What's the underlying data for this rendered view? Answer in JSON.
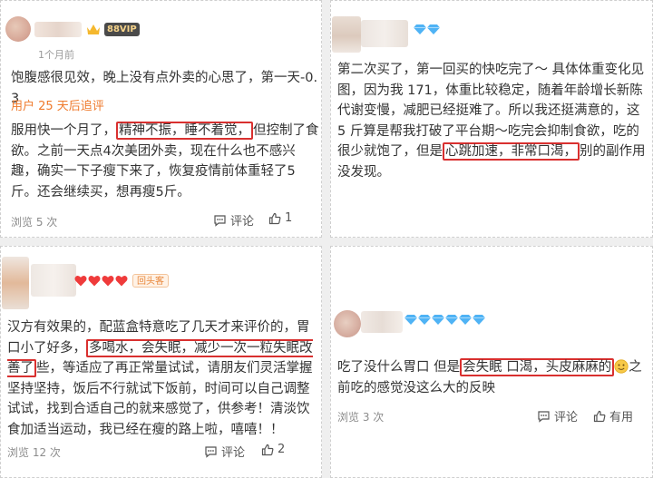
{
  "posts": [
    {
      "meta": "1个月前",
      "vip_label": "88VIP",
      "line1": "饱腹感很见效，晚上没有点外卖的心思了，第一天-0.3",
      "followup": "用户 25 天后追评",
      "body_pre": "服用快一个月了，",
      "body_hl": "精神不振，睡不着觉，",
      "body_post": "但控制了食欲。之前一天点4次美团外卖，现在什么也不感兴趣，确实一下子瘦下来了，恢复疫情前体重轻了5斤。还会继续买，想再瘦5斤。",
      "views": "浏览 5 次",
      "comment_label": "评论",
      "like_count": "1"
    },
    {
      "body_pre": "第二次买了，第一回买的快吃完了～ 具体体重变化见图，因为我 171，体重比较稳定，随着年龄增长新陈代谢变慢，减肥已经挺难了。所以我还挺满意的，这 5 斤算是帮我打破了平台期～吃完会抑制食欲，吃的很少就饱了，但是",
      "body_hl": "心跳加速，非常口渴，",
      "body_post": "别的副作用没发现。"
    },
    {
      "repeat_label": "回头客",
      "body_pre": "汉方有效果的，配蓝盒特意吃了几天才来评价的，胃口小了好多，",
      "body_hl": "多喝水，会失眠，减少一次一粒失眠改善了",
      "body_post": "些，等适应了再正常量试试，请朋友们灵活掌握坚持坚持，饭后不行就试下饭前，时间可以自己调整试试，找到合适自己的就来感觉了，供参考！清淡饮食加适当运动，我已经在瘦的路上啦，嘻嘻！！",
      "views": "浏览 12 次",
      "comment_label": "评论",
      "like_count": "2"
    },
    {
      "body_pre": "吃了没什么胃口 但是",
      "body_hl": "会失眠 口渴，头皮麻麻的",
      "body_post": "之前吃的感觉没这么大的反映",
      "views": "浏览 3 次",
      "comment_label": "评论",
      "useful_label": "有用"
    }
  ],
  "icons": [
    "crown-icon",
    "diamond-icon",
    "heart-icon",
    "comment-icon",
    "thumbs-up-icon",
    "smile-emoji-icon"
  ],
  "colors": {
    "highlight": "#d9302f",
    "followup": "#ef7a2c",
    "diamond": "#4fb3f5",
    "heart": "#ef3b3b"
  }
}
